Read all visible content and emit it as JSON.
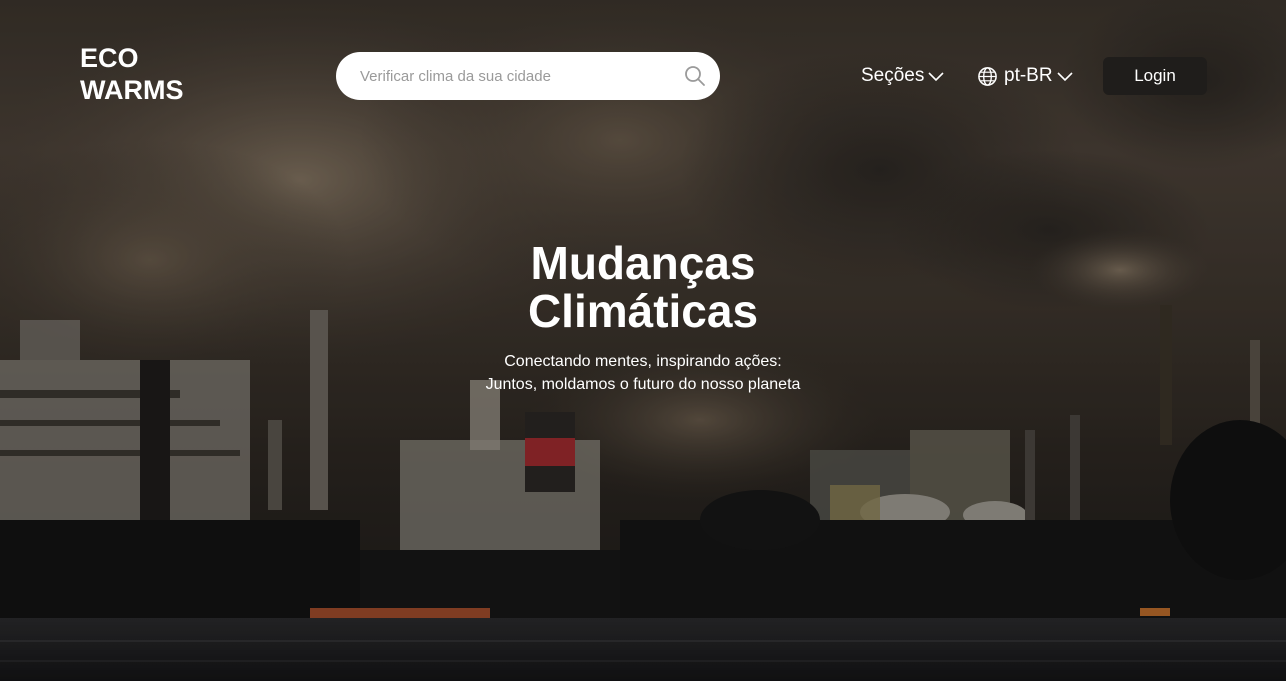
{
  "header": {
    "logo_line1": "ECO",
    "logo_line2": "WARMS",
    "search": {
      "placeholder": "Verificar clima da sua cidade"
    },
    "nav": {
      "sections_label": "Seções",
      "language_label": "pt-BR",
      "login_label": "Login"
    }
  },
  "hero": {
    "title_line1": "Mudanças",
    "title_line2": "Climáticas",
    "subtitle_line1": "Conectando mentes, inspirando ações:",
    "subtitle_line2": "Juntos, moldamos o futuro do nosso planeta"
  },
  "icons": {
    "search": "search-icon",
    "sections_dropdown": "chevron-down-icon",
    "language": "globe-icon",
    "language_dropdown": "chevron-down-icon"
  },
  "colors": {
    "login_bg": "#1f1d1b",
    "search_bg": "#ffffff",
    "text": "#ffffff"
  }
}
